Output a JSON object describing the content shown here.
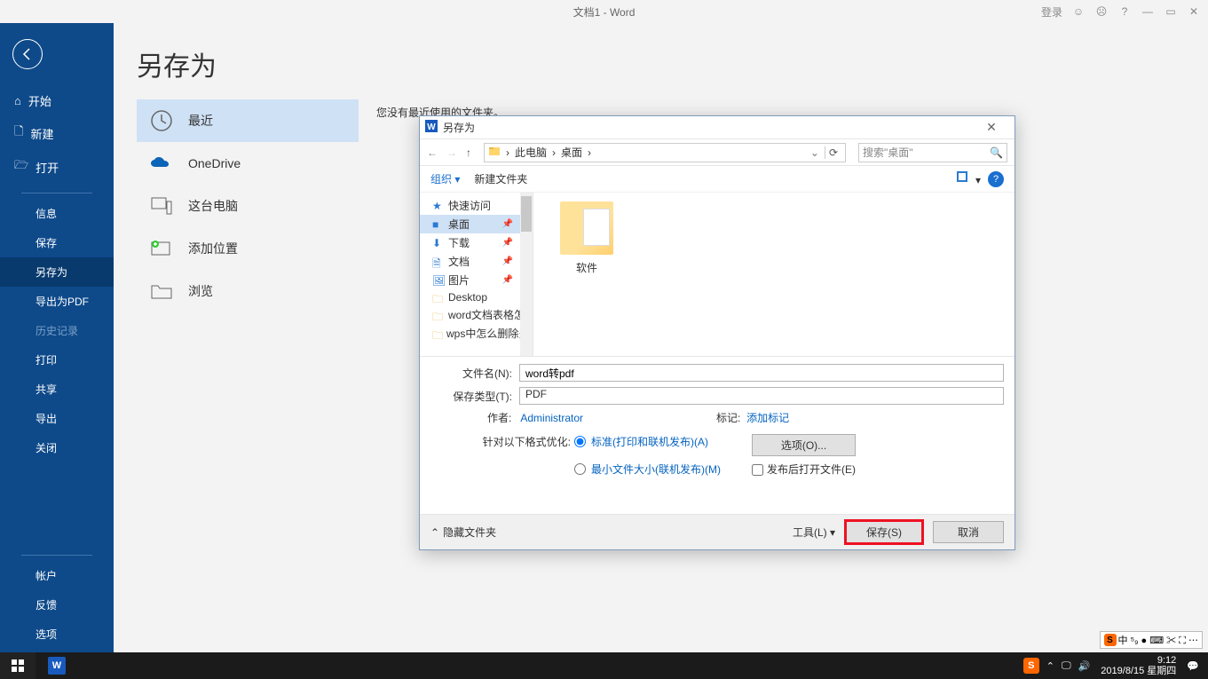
{
  "titlebar": {
    "center": "文档1  -  Word",
    "login": "登录"
  },
  "backstage": {
    "title": "另存为",
    "back_tooltip": "返回",
    "nav": {
      "home": "开始",
      "new": "新建",
      "open": "打开",
      "info": "信息",
      "save": "保存",
      "saveas": "另存为",
      "exportpdf": "导出为PDF",
      "history": "历史记录",
      "print": "打印",
      "share": "共享",
      "export": "导出",
      "close": "关闭",
      "account": "帐户",
      "feedback": "反馈",
      "options": "选项"
    },
    "locations": {
      "recent": "最近",
      "onedrive": "OneDrive",
      "thispc": "这台电脑",
      "addplace": "添加位置",
      "browse": "浏览"
    },
    "recent_msg": "您没有最近使用的文件夹。"
  },
  "dialog": {
    "title": "另存为",
    "breadcrumb": {
      "root": "此电脑",
      "sep": "›",
      "current": "桌面"
    },
    "refresh_tip": "刷新",
    "search_placeholder": "搜索\"桌面\"",
    "toolbar": {
      "organize": "组织 ▾",
      "newfolder": "新建文件夹"
    },
    "tree": {
      "quick": "快速访问",
      "desktop": "桌面",
      "downloads": "下载",
      "documents": "文档",
      "pictures": "图片",
      "desktop_en": "Desktop",
      "folder1": "word文档表格怎",
      "folder2": "wps中怎么删除多"
    },
    "file_item": "软件",
    "fields": {
      "filename_label": "文件名(N):",
      "filename_value": "word转pdf",
      "type_label": "保存类型(T):",
      "type_value": "PDF",
      "author_label": "作者:",
      "author_value": "Administrator",
      "tags_label": "标记:",
      "tags_value": "添加标记"
    },
    "optimize": {
      "heading": "针对以下格式优化:",
      "standard": "标准(打印和联机发布)(A)",
      "min": "最小文件大小(联机发布)(M)",
      "options_btn": "选项(O)...",
      "open_after": "发布后打开文件(E)"
    },
    "footer": {
      "hide": "隐藏文件夹",
      "tools": "工具(L)  ▾",
      "save": "保存(S)",
      "cancel": "取消"
    }
  },
  "taskbar": {
    "time": "9:12",
    "date": "2019/8/15 星期四",
    "ime_chars": "中 ⁵₉ ● ⌨ ✂ ⛶ ⋯"
  }
}
